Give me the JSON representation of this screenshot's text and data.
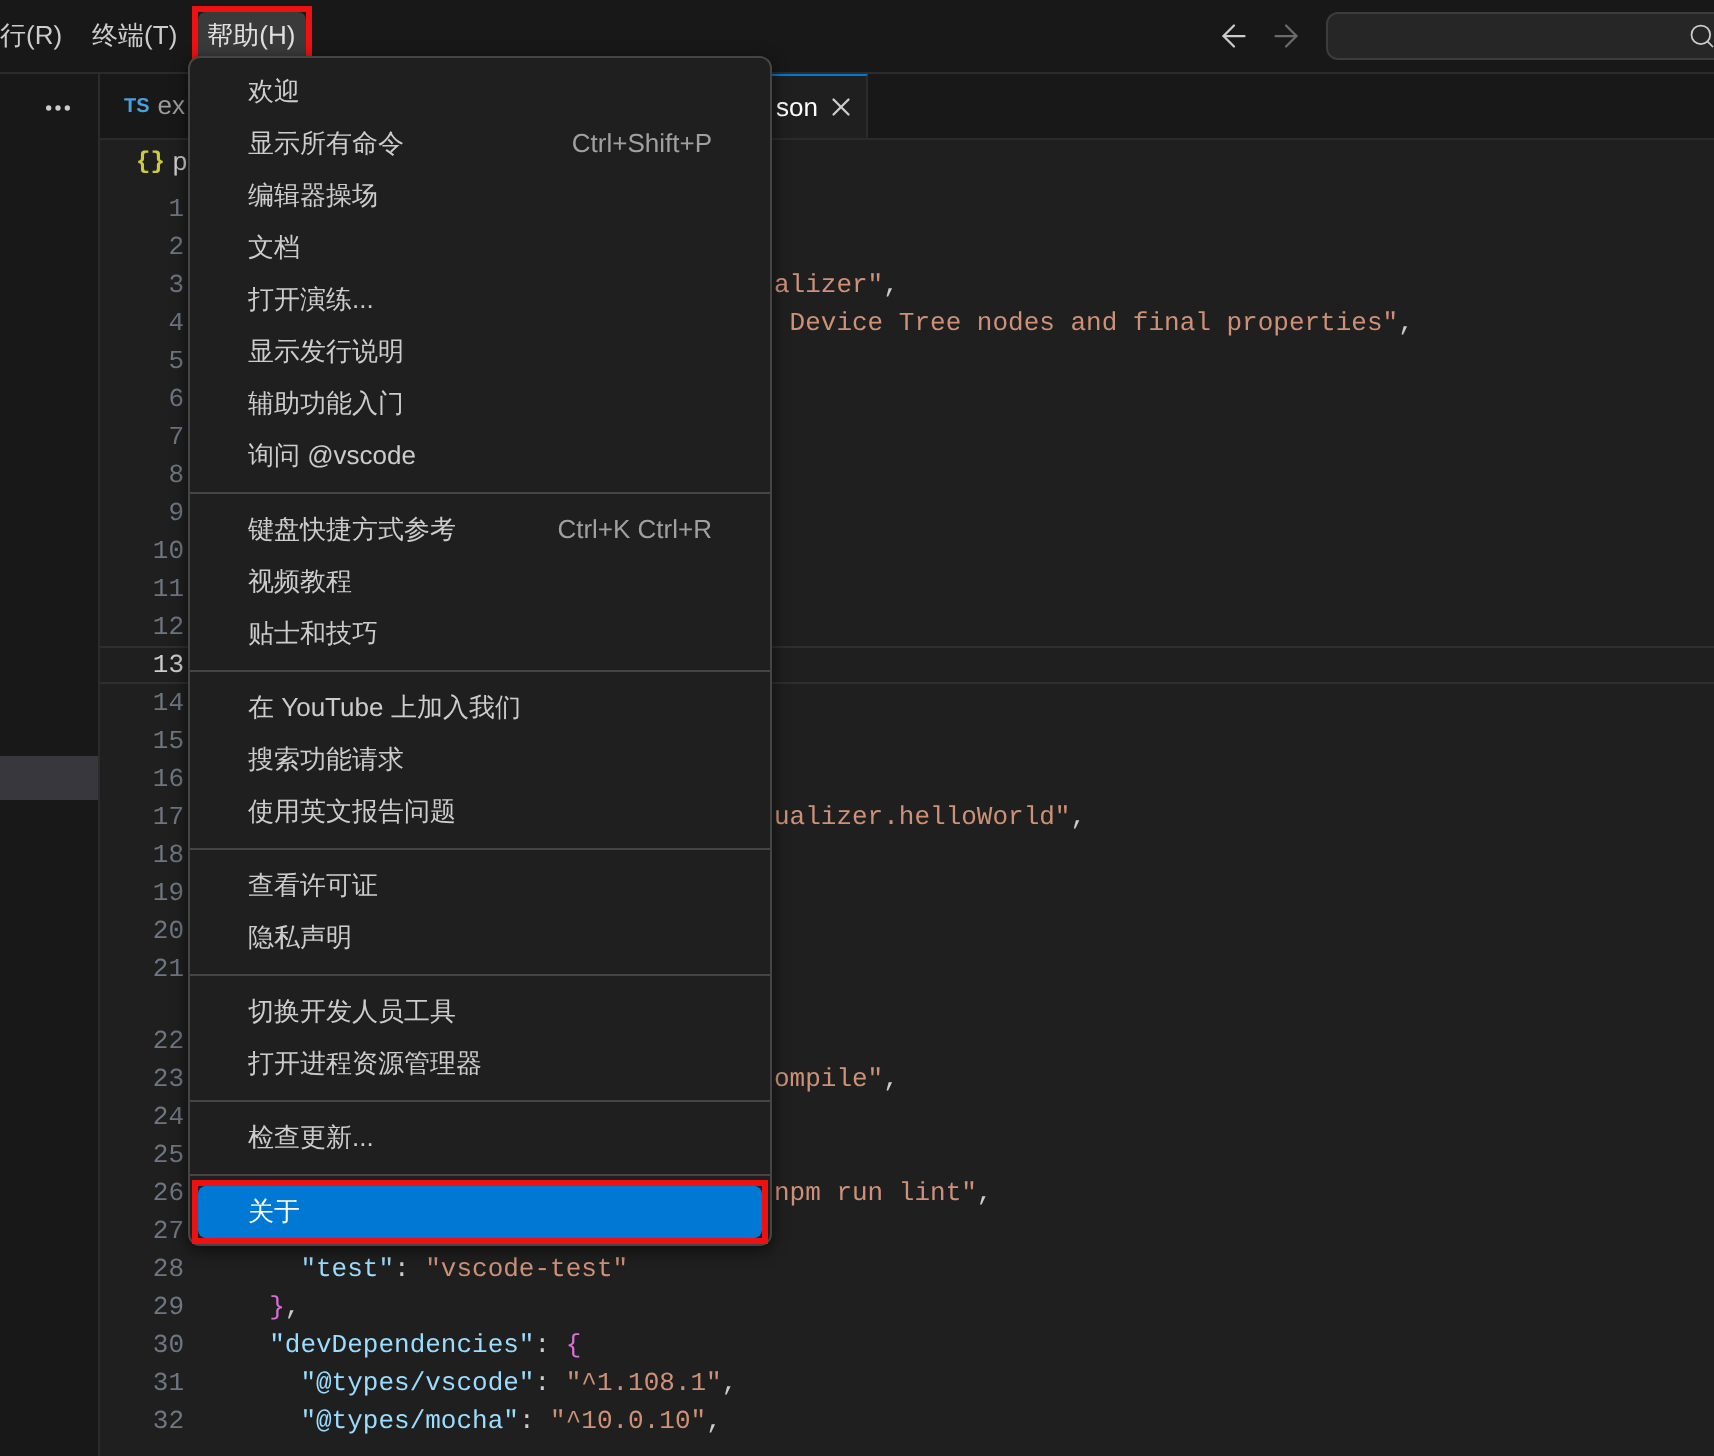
{
  "menubar": [
    {
      "label": "行(R)",
      "selected": false,
      "marked": false
    },
    {
      "label": "终端(T)",
      "selected": false,
      "marked": false
    },
    {
      "label": "帮助(H)",
      "selected": true,
      "marked": true
    }
  ],
  "nav": {
    "back_disabled": false,
    "forward_disabled": true
  },
  "sidebar": {
    "items": [
      {
        "selected": true
      }
    ]
  },
  "tabs": [
    {
      "badge": "TS",
      "label": "ex",
      "selected": false
    },
    {
      "label": "son",
      "selected": true,
      "closable": true
    }
  ],
  "breadcrumb": {
    "icon_text": "{}",
    "label": "p"
  },
  "code_lines": [
    {
      "number": "1"
    },
    {
      "number": "2"
    },
    {
      "number": "3",
      "kind": "behind-menu",
      "tokens": [
        {
          "text": "alizer\"",
          "kind": "string"
        },
        {
          "text": ",",
          "kind": "punct"
        }
      ]
    },
    {
      "number": "4",
      "kind": "behind-menu",
      "tokens": [
        {
          "text": " Device Tree nodes and final properties\"",
          "kind": "string"
        },
        {
          "text": ",",
          "kind": "punct"
        }
      ]
    },
    {
      "number": "5"
    },
    {
      "number": "6"
    },
    {
      "number": "7"
    },
    {
      "number": "8"
    },
    {
      "number": "9"
    },
    {
      "number": "10"
    },
    {
      "number": "11"
    },
    {
      "number": "12"
    },
    {
      "number": "13",
      "current": true
    },
    {
      "number": "14"
    },
    {
      "number": "15"
    },
    {
      "number": "16"
    },
    {
      "number": "17",
      "kind": "behind-menu",
      "tokens": [
        {
          "text": "ualizer.helloWorld\"",
          "kind": "string"
        },
        {
          "text": ",",
          "kind": "punct"
        }
      ]
    },
    {
      "number": "18"
    },
    {
      "number": "19"
    },
    {
      "number": "20"
    },
    {
      "number": "21"
    },
    {
      "number": "22",
      "codelens_above": true
    },
    {
      "number": "23",
      "kind": "behind-menu",
      "tokens": [
        {
          "text": "ompile\"",
          "kind": "string"
        },
        {
          "text": ",",
          "kind": "punct"
        }
      ]
    },
    {
      "number": "24"
    },
    {
      "number": "25"
    },
    {
      "number": "26",
      "kind": "behind-menu",
      "tokens": [
        {
          "text": "npm run lint\"",
          "kind": "string"
        },
        {
          "text": ",",
          "kind": "punct"
        }
      ]
    },
    {
      "number": "27"
    },
    {
      "number": "28",
      "kind": "plain",
      "tokens": [
        {
          "text": "    \"test\"",
          "kind": "key"
        },
        {
          "text": ": ",
          "kind": "punct"
        },
        {
          "text": "\"vscode-test\"",
          "kind": "string"
        }
      ]
    },
    {
      "number": "29",
      "kind": "plain",
      "tokens": [
        {
          "text": "  }",
          "kind": "bracket"
        },
        {
          "text": ",",
          "kind": "punct"
        }
      ]
    },
    {
      "number": "30",
      "kind": "plain",
      "tokens": [
        {
          "text": "  \"devDependencies\"",
          "kind": "key"
        },
        {
          "text": ": ",
          "kind": "punct"
        },
        {
          "text": "{",
          "kind": "bracket"
        }
      ]
    },
    {
      "number": "31",
      "kind": "plain",
      "tokens": [
        {
          "text": "    \"@types/vscode\"",
          "kind": "key"
        },
        {
          "text": ": ",
          "kind": "punct"
        },
        {
          "text": "\"^1.108.1\"",
          "kind": "string"
        },
        {
          "text": ",",
          "kind": "punct"
        }
      ]
    },
    {
      "number": "32",
      "kind": "plain",
      "tokens": [
        {
          "text": "    \"@types/mocha\"",
          "kind": "key"
        },
        {
          "text": ": ",
          "kind": "punct"
        },
        {
          "text": "\"^10.0.10\"",
          "kind": "string"
        },
        {
          "text": ",",
          "kind": "punct"
        }
      ]
    }
  ],
  "help_menu": {
    "groups": [
      [
        {
          "label": "欢迎",
          "selected": false,
          "marked": false
        },
        {
          "label": "显示所有命令",
          "shortcut": "Ctrl+Shift+P",
          "selected": false,
          "marked": false
        },
        {
          "label": "编辑器操场",
          "selected": false,
          "marked": false
        },
        {
          "label": "文档",
          "selected": false,
          "marked": false
        },
        {
          "label": "打开演练...",
          "selected": false,
          "marked": false
        },
        {
          "label": "显示发行说明",
          "selected": false,
          "marked": false
        },
        {
          "label": "辅助功能入门",
          "selected": false,
          "marked": false
        },
        {
          "label": "询问 @vscode",
          "selected": false,
          "marked": false
        }
      ],
      [
        {
          "label": "键盘快捷方式参考",
          "shortcut": "Ctrl+K Ctrl+R",
          "selected": false,
          "marked": false
        },
        {
          "label": "视频教程",
          "selected": false,
          "marked": false
        },
        {
          "label": "贴士和技巧",
          "selected": false,
          "marked": false
        }
      ],
      [
        {
          "label": "在 YouTube 上加入我们",
          "selected": false,
          "marked": false
        },
        {
          "label": "搜索功能请求",
          "selected": false,
          "marked": false
        },
        {
          "label": "使用英文报告问题",
          "selected": false,
          "marked": false
        }
      ],
      [
        {
          "label": "查看许可证",
          "selected": false,
          "marked": false
        },
        {
          "label": "隐私声明",
          "selected": false,
          "marked": false
        }
      ],
      [
        {
          "label": "切换开发人员工具",
          "selected": false,
          "marked": false
        },
        {
          "label": "打开进程资源管理器",
          "selected": false,
          "marked": false
        }
      ],
      [
        {
          "label": "检查更新...",
          "selected": false,
          "marked": false
        }
      ],
      [
        {
          "label": "关于",
          "selected": true,
          "marked": true
        }
      ]
    ]
  }
}
